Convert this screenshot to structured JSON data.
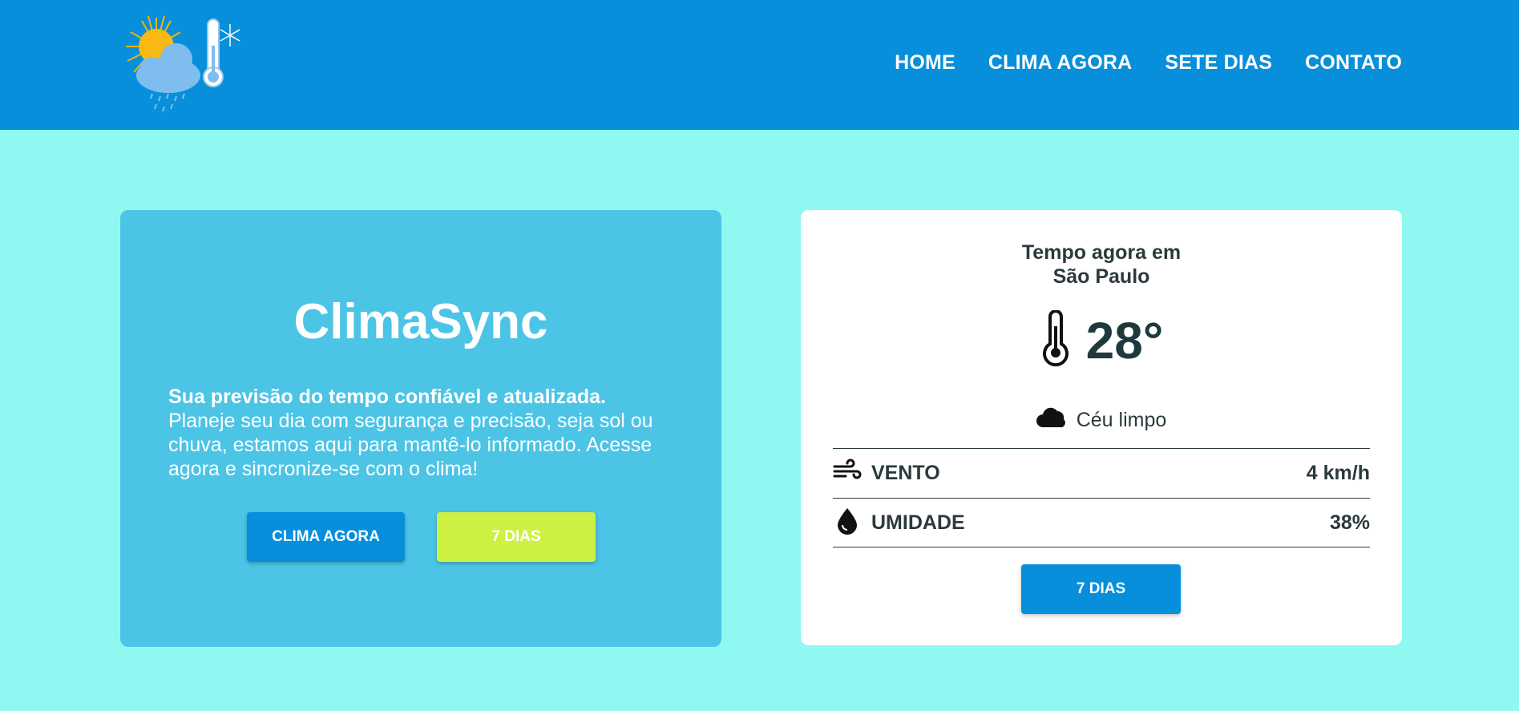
{
  "colors": {
    "header_bg": "#078fdb",
    "page_bg": "#8ff9f1",
    "hero_bg": "#4cc4e6",
    "primary_button": "#078fdb",
    "secondary_button": "#cdf143"
  },
  "nav": {
    "items": [
      {
        "label": "HOME"
      },
      {
        "label": "CLIMA AGORA"
      },
      {
        "label": "SETE DIAS"
      },
      {
        "label": "CONTATO"
      }
    ]
  },
  "hero": {
    "title": "ClimaSync",
    "lead": "Sua previsão do tempo confiável e atualizada.",
    "body": "Planeje seu dia com segurança e precisão, seja sol ou chuva, estamos aqui para mantê-lo informado. Acesse agora e sincronize-se com o clima!",
    "buttons": {
      "now": "CLIMA AGORA",
      "seven": "7 DIAS"
    }
  },
  "weather": {
    "title_line1": "Tempo agora em",
    "title_line2": "São Paulo",
    "temperature": "28°",
    "condition": "Céu limpo",
    "condition_icon": "cloud-icon",
    "wind": {
      "label": "VENTO",
      "value": "4 km/h",
      "icon": "wind-icon"
    },
    "humidity": {
      "label": "UMIDADE",
      "value": "38%",
      "icon": "droplet-icon"
    },
    "button": "7 DIAS"
  }
}
